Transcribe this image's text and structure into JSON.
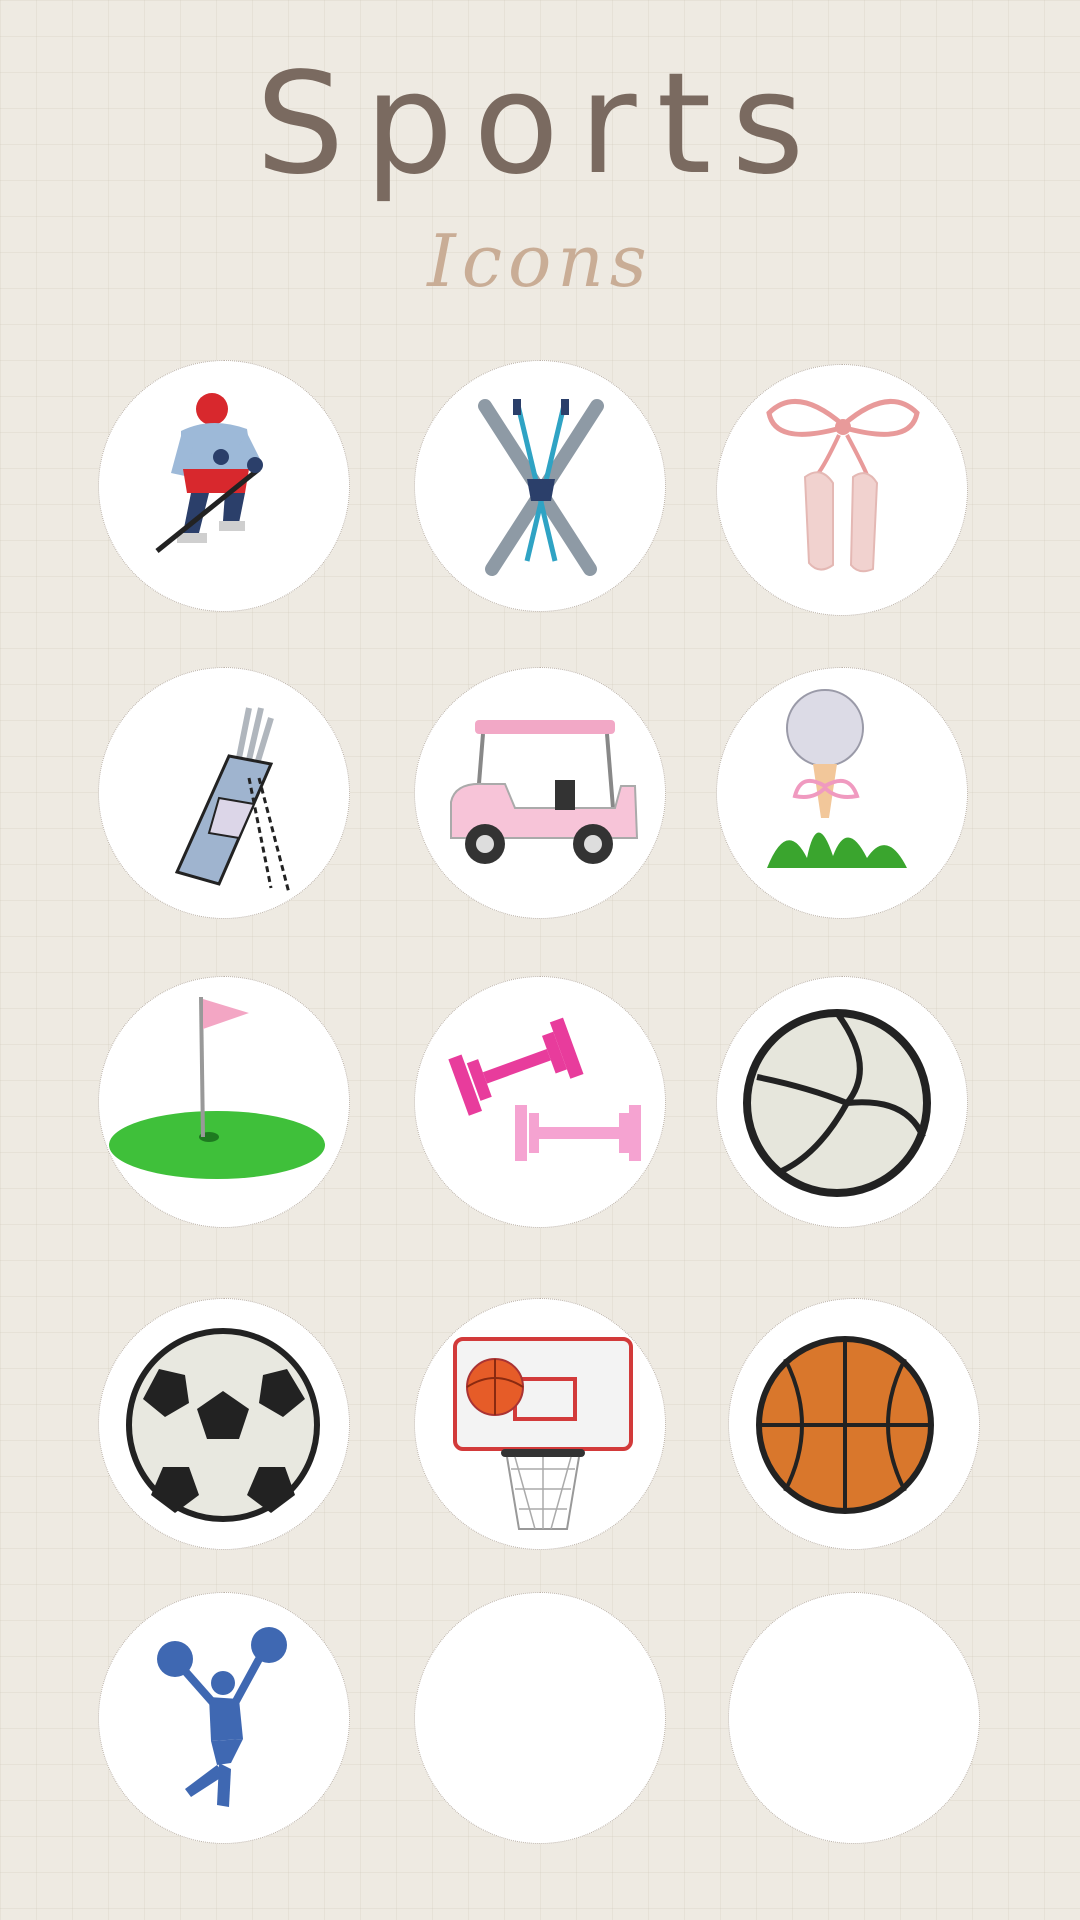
{
  "header": {
    "title": "Sports",
    "subtitle": "Icons"
  },
  "icons": [
    {
      "name": "hockey-player-icon"
    },
    {
      "name": "skis-icon"
    },
    {
      "name": "ballet-slippers-icon"
    },
    {
      "name": "golf-bag-icon"
    },
    {
      "name": "golf-cart-icon"
    },
    {
      "name": "golf-ball-on-tee-icon"
    },
    {
      "name": "golf-flag-icon"
    },
    {
      "name": "dumbbells-icon"
    },
    {
      "name": "volleyball-icon"
    },
    {
      "name": "soccer-ball-icon"
    },
    {
      "name": "basketball-hoop-icon"
    },
    {
      "name": "basketball-icon"
    },
    {
      "name": "cheerleader-icon"
    },
    {
      "name": "empty-slot"
    },
    {
      "name": "empty-slot"
    }
  ],
  "colors": {
    "background": "#eeeae2",
    "title": "#7a6a60",
    "subtitle": "#c9ad96",
    "circle": "#ffffff"
  }
}
